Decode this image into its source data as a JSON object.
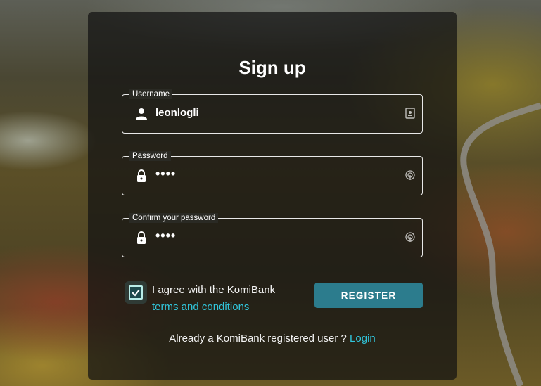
{
  "form": {
    "title": "Sign up",
    "username": {
      "label": "Username",
      "value": "leonlogli"
    },
    "password": {
      "label": "Password",
      "value": "••••"
    },
    "confirm": {
      "label": "Confirm your password",
      "value": "••••"
    },
    "agreement": {
      "text": "I agree with the KomiBank",
      "link": "terms and conditions",
      "checked": true
    },
    "register_label": "REGISTER",
    "already_text": "Already a KomiBank registered user ?",
    "login_link": "Login"
  },
  "colors": {
    "accent": "#31c6dc",
    "button": "#2c7c8d"
  },
  "icons": {
    "username_lead": "person-icon",
    "username_trail": "contact-card-icon",
    "password_lead": "lock-icon",
    "password_trail": "fingerprint-icon",
    "confirm_lead": "lock-icon",
    "confirm_trail": "fingerprint-icon"
  }
}
